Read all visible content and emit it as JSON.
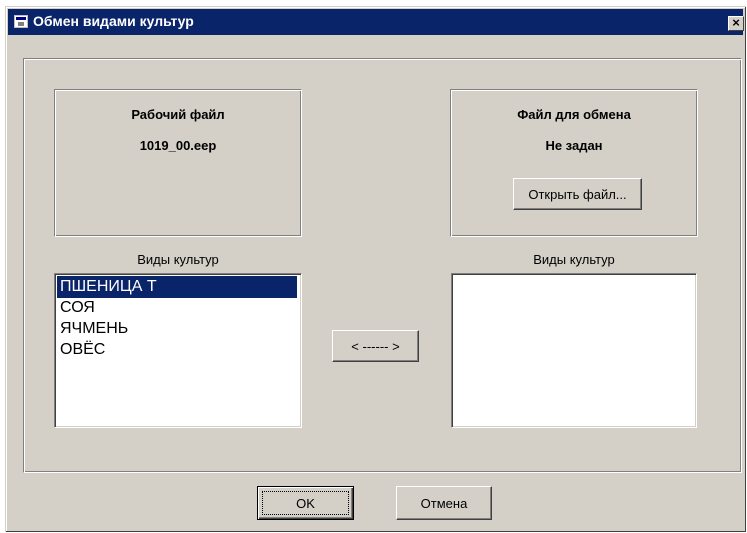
{
  "window": {
    "title": "Обмен видами культур",
    "close_label": "×",
    "icon": "app-window-icon"
  },
  "working_file": {
    "title": "Рабочий файл",
    "name": "1019_00.eep"
  },
  "exchange_file": {
    "title": "Файл для обмена",
    "status": "Не задан",
    "open_button": "Открыть файл..."
  },
  "left_list": {
    "label": "Виды культур",
    "items": [
      "ПШЕНИЦА Т",
      "СОЯ",
      "ЯЧМЕНЬ",
      "ОВЁС"
    ],
    "selected_index": 0
  },
  "right_list": {
    "label": "Виды культур",
    "items": []
  },
  "transfer_button": "< ------ >",
  "buttons": {
    "ok": "OK",
    "cancel": "Отмена"
  },
  "colors": {
    "face": "#d4d0c8",
    "titlebar": "#0a246a",
    "selection": "#0a246a"
  }
}
